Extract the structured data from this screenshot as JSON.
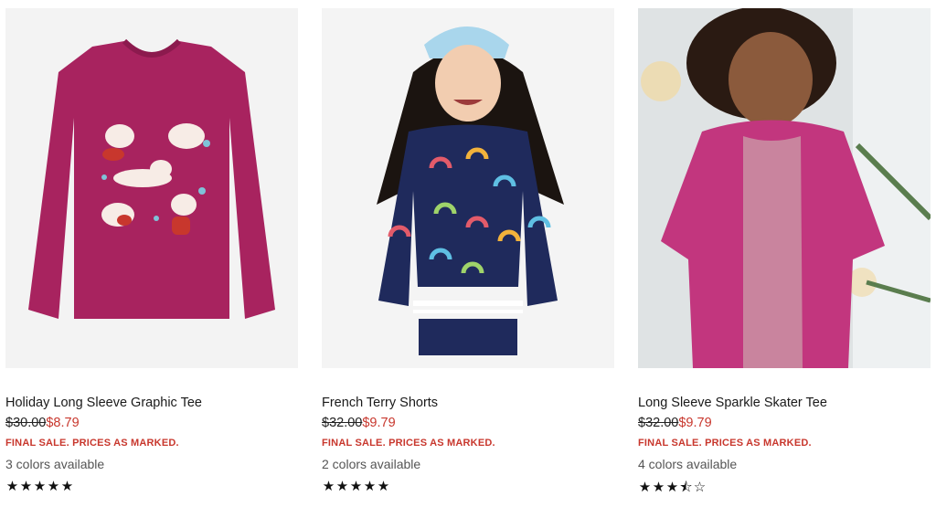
{
  "products": [
    {
      "title": "Holiday Long Sleeve Graphic Tee",
      "original_price": "$30.00",
      "sale_price": "$8.79",
      "final_sale": "FINAL SALE. PRICES AS MARKED.",
      "colors": "3 colors available",
      "stars": [
        "★",
        "★",
        "★",
        "★",
        "★"
      ],
      "rating": 5,
      "image": "magenta-long-sleeve-tee-cats"
    },
    {
      "title": "French Terry Shorts",
      "original_price": "$32.00",
      "sale_price": "$9.79",
      "final_sale": "FINAL SALE. PRICES AS MARKED.",
      "colors": "2 colors available",
      "stars": [
        "★",
        "★",
        "★",
        "★",
        "★"
      ],
      "rating": 5,
      "image": "girl-navy-rainbow-sweatshirt"
    },
    {
      "title": "Long Sleeve Sparkle Skater Tee",
      "original_price": "$32.00",
      "sale_price": "$9.79",
      "final_sale": "FINAL SALE. PRICES AS MARKED.",
      "colors": "4 colors available",
      "stars": [
        "★",
        "★",
        "★",
        "⯪",
        "☆"
      ],
      "rating": 3.5,
      "image": "girl-pink-cardigan"
    }
  ],
  "colors": {
    "sale_red": "#c8372d",
    "tee_magenta": "#a8235f",
    "navy": "#1f2a5c",
    "pink": "#c2367e"
  }
}
